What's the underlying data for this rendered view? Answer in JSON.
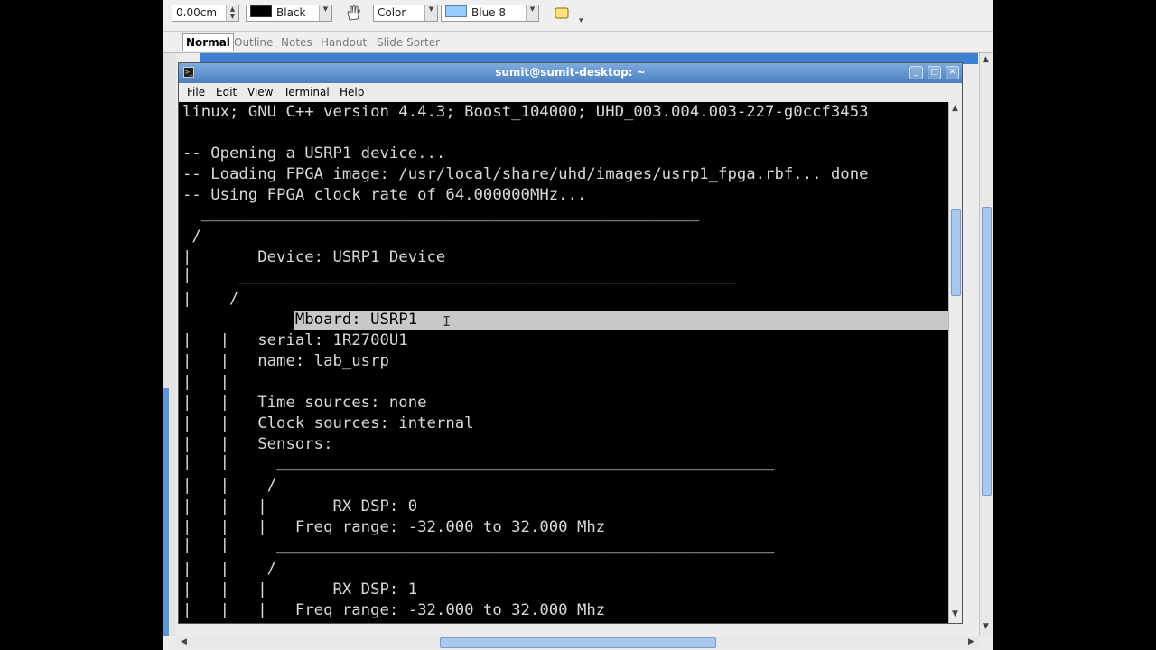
{
  "toolbar": {
    "line_width": "0.00cm",
    "line_color_label": "Black",
    "line_color": "#000000",
    "area_style_label": "Color",
    "area_color_label": "Blue 8",
    "area_color": "#99ccff"
  },
  "view_tabs": [
    {
      "label": "Normal",
      "active": true
    },
    {
      "label": "Outline",
      "active": false
    },
    {
      "label": "Notes",
      "active": false
    },
    {
      "label": "Handout",
      "active": false
    },
    {
      "label": "Slide Sorter",
      "active": false
    }
  ],
  "terminal": {
    "title": "sumit@sumit-desktop: ~",
    "menu": [
      {
        "label": "File"
      },
      {
        "label": "Edit"
      },
      {
        "label": "View"
      },
      {
        "label": "Terminal"
      },
      {
        "label": "Help"
      }
    ],
    "lines": [
      "linux; GNU C++ version 4.4.3; Boost_104000; UHD_003.004.003-227-g0ccf3453",
      "",
      "-- Opening a USRP1 device...",
      "-- Loading FPGA image: /usr/local/share/uhd/images/usrp1_fpga.rbf... done",
      "-- Using FPGA clock rate of 64.000000MHz...",
      "  _____________________________________________________",
      " /",
      "|       Device: USRP1 Device",
      "|     _____________________________________________________",
      "|    /",
      "|   |       Mboard: USRP1",
      "|   |   serial: 1R2700U1",
      "|   |   name: lab_usrp",
      "|   |",
      "|   |   Time sources: none",
      "|   |   Clock sources: internal",
      "|   |   Sensors:",
      "|   |     _____________________________________________________",
      "|   |    /",
      "|   |   |       RX DSP: 0",
      "|   |   |   Freq range: -32.000 to 32.000 Mhz",
      "|   |     _____________________________________________________",
      "|   |    /",
      "|   |   |       RX DSP: 1",
      "|   |   |   Freq range: -32.000 to 32.000 Mhz"
    ]
  }
}
